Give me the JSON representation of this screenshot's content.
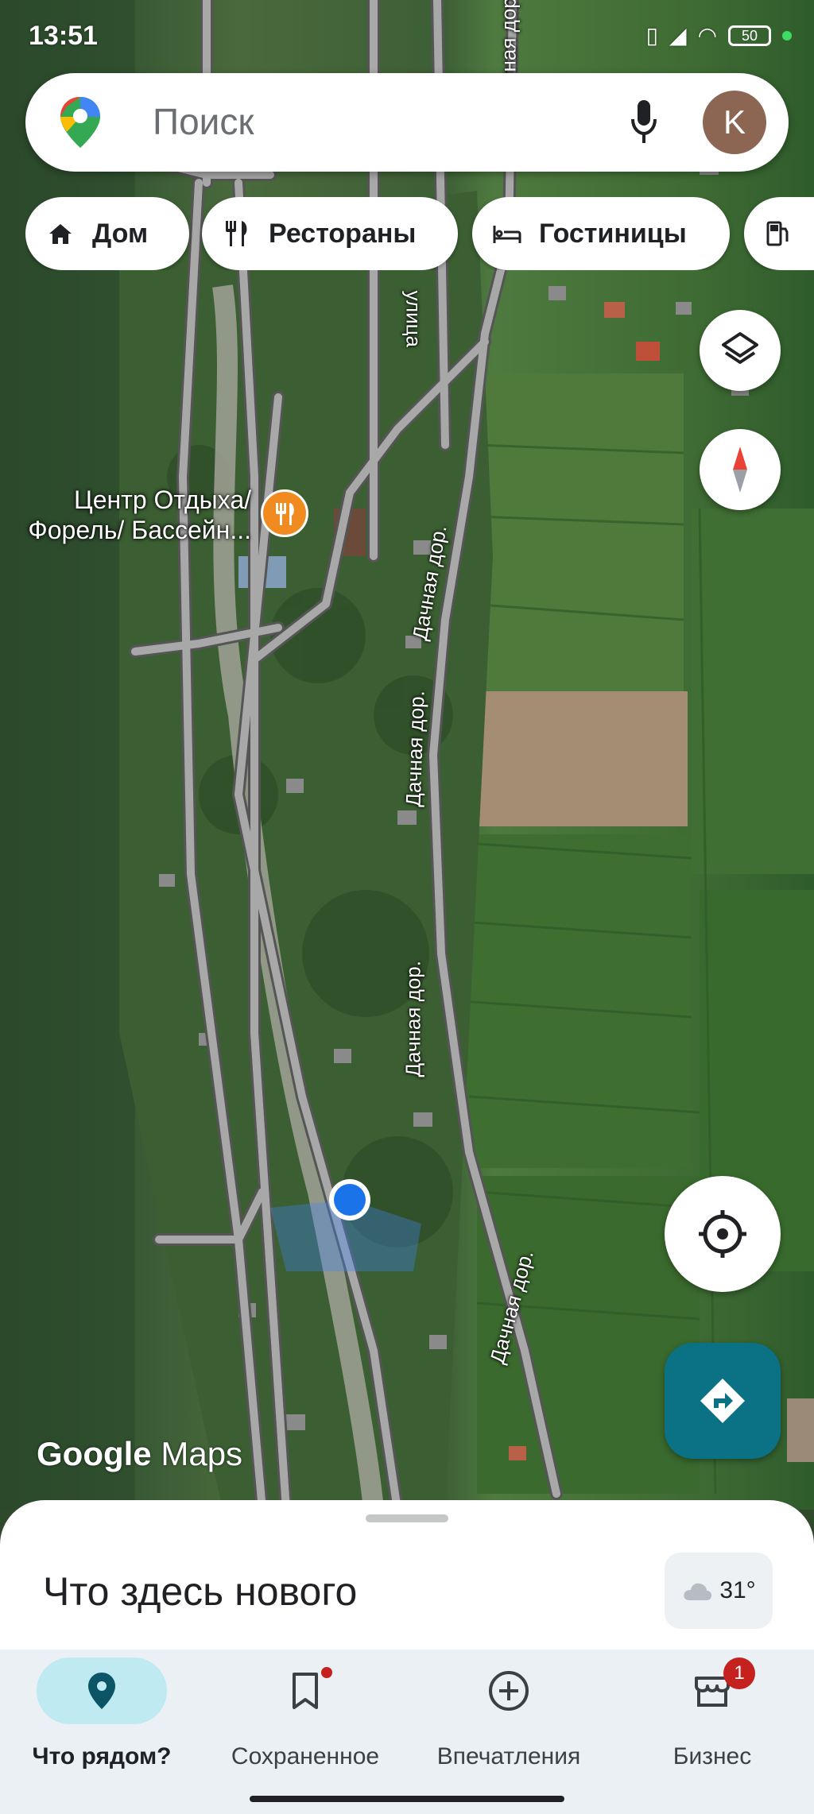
{
  "status_bar": {
    "time": "13:51",
    "battery": "50"
  },
  "search": {
    "placeholder": "Поиск",
    "avatar_letter": "K"
  },
  "chips": [
    {
      "label": "Дом",
      "icon": "home-icon"
    },
    {
      "label": "Рестораны",
      "icon": "restaurant-icon"
    },
    {
      "label": "Гостиницы",
      "icon": "hotel-icon"
    },
    {
      "label": "",
      "icon": "gas-station-icon"
    }
  ],
  "map": {
    "poi_label_line1": "Центр Отдыха/",
    "poi_label_line2": "Форель/ Бассейн...",
    "road_labels": [
      "Дачная дор.",
      "Дачная дор.",
      "Дачная дор.",
      "Дачная дор.",
      "Дачная дор."
    ],
    "top_road_labels": [
      "улица",
      "Дачная дор"
    ],
    "logo_google": "Google",
    "logo_maps": "Maps"
  },
  "sheet": {
    "title": "Что здесь нового",
    "temperature": "31°",
    "weather_icon": "cloud-icon"
  },
  "nav": [
    {
      "label": "Что рядом?",
      "icon": "location-pin-icon",
      "active": true
    },
    {
      "label": "Сохраненное",
      "icon": "bookmark-icon"
    },
    {
      "label": "Впечатления",
      "icon": "add-circle-icon"
    },
    {
      "label": "Бизнес",
      "icon": "store-icon",
      "badge": "1"
    }
  ],
  "colors": {
    "accent": "#0b7285",
    "active_nav_bg": "#bfeaf2",
    "badge": "#c5221f",
    "poi": "#f28b1f"
  }
}
